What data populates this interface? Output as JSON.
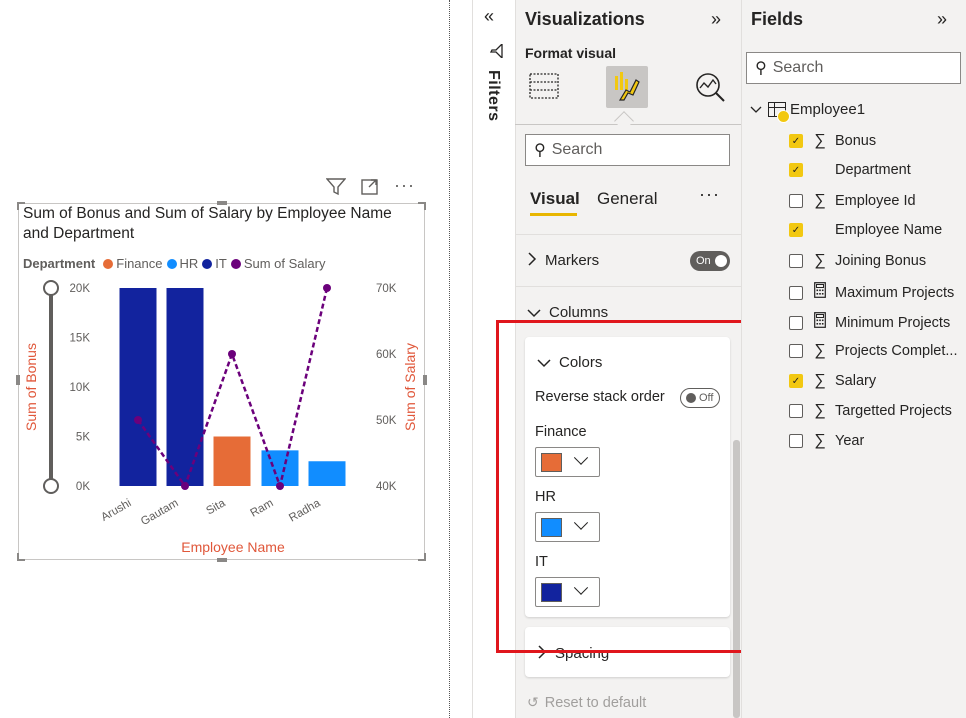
{
  "visual": {
    "title": "Sum of Bonus and Sum of Salary by Employee Name and Department",
    "legend_title": "Department",
    "header_icons": [
      "filter-icon",
      "focus-mode-icon",
      "more-options-icon"
    ]
  },
  "chart_data": {
    "type": "bar",
    "title": "Sum of Bonus and Sum of Salary by Employee Name and Department",
    "xlabel": "Employee Name",
    "ylabel": "Sum of Bonus",
    "y2label": "Sum of Salary",
    "categories": [
      "Arushi",
      "Gautam",
      "Sita",
      "Ram",
      "Radha"
    ],
    "legend_title": "Department",
    "legend": [
      {
        "name": "Finance",
        "color": "#e66c37"
      },
      {
        "name": "HR",
        "color": "#118dff"
      },
      {
        "name": "IT",
        "color": "#12239e"
      },
      {
        "name": "Sum of Salary",
        "color": "#6b007b"
      }
    ],
    "bars": [
      {
        "category": "Arushi",
        "department": "IT",
        "value": 20000,
        "color": "#12239e"
      },
      {
        "category": "Gautam",
        "department": "IT",
        "value": 20000,
        "color": "#12239e"
      },
      {
        "category": "Sita",
        "department": "Finance",
        "value": 5000,
        "color": "#e66c37"
      },
      {
        "category": "Ram",
        "department": "HR",
        "value": 3600,
        "color": "#118dff"
      },
      {
        "category": "Radha",
        "department": "HR",
        "value": 2500,
        "color": "#118dff"
      }
    ],
    "line": {
      "name": "Sum of Salary",
      "color": "#6b007b",
      "values": [
        50000,
        40000,
        60000,
        40000,
        70000
      ]
    },
    "ylim": [
      0,
      20000
    ],
    "y_ticks": [
      "0K",
      "5K",
      "10K",
      "15K",
      "20K"
    ],
    "y2lim": [
      40000,
      70000
    ],
    "y2_ticks": [
      "40K",
      "50K",
      "60K",
      "70K"
    ],
    "axis_title_color": "#e0573a",
    "legend_position": "top-left"
  },
  "filters": {
    "label": "Filters"
  },
  "visualizations": {
    "title": "Visualizations",
    "subtitle": "Format visual",
    "search_placeholder": "Search",
    "tabs": {
      "visual": "Visual",
      "general": "General",
      "more": "···"
    },
    "markers": {
      "label": "Markers",
      "toggle": "On"
    },
    "columns": {
      "label": "Columns"
    },
    "colors": {
      "label": "Colors",
      "reverse_label": "Reverse stack order",
      "reverse_toggle": "Off",
      "items": [
        {
          "label": "Finance",
          "color": "#e66c37"
        },
        {
          "label": "HR",
          "color": "#118dff"
        },
        {
          "label": "IT",
          "color": "#12239e"
        }
      ]
    },
    "spacing": {
      "label": "Spacing"
    },
    "reset": "Reset to default"
  },
  "fields": {
    "title": "Fields",
    "search_placeholder": "Search",
    "table": "Employee1",
    "items": [
      {
        "name": "Bonus",
        "checked": true,
        "type": "sigma"
      },
      {
        "name": "Department",
        "checked": true,
        "type": "none"
      },
      {
        "name": "Employee Id",
        "checked": false,
        "type": "sigma"
      },
      {
        "name": "Employee Name",
        "checked": true,
        "type": "none"
      },
      {
        "name": "Joining Bonus",
        "checked": false,
        "type": "sigma"
      },
      {
        "name": "Maximum Projects",
        "checked": false,
        "type": "calc"
      },
      {
        "name": "Minimum Projects",
        "checked": false,
        "type": "calc"
      },
      {
        "name": "Projects Complet...",
        "checked": false,
        "type": "sigma"
      },
      {
        "name": "Salary",
        "checked": true,
        "type": "sigma"
      },
      {
        "name": "Targetted Projects",
        "checked": false,
        "type": "sigma"
      },
      {
        "name": "Year",
        "checked": false,
        "type": "sigma"
      }
    ]
  }
}
